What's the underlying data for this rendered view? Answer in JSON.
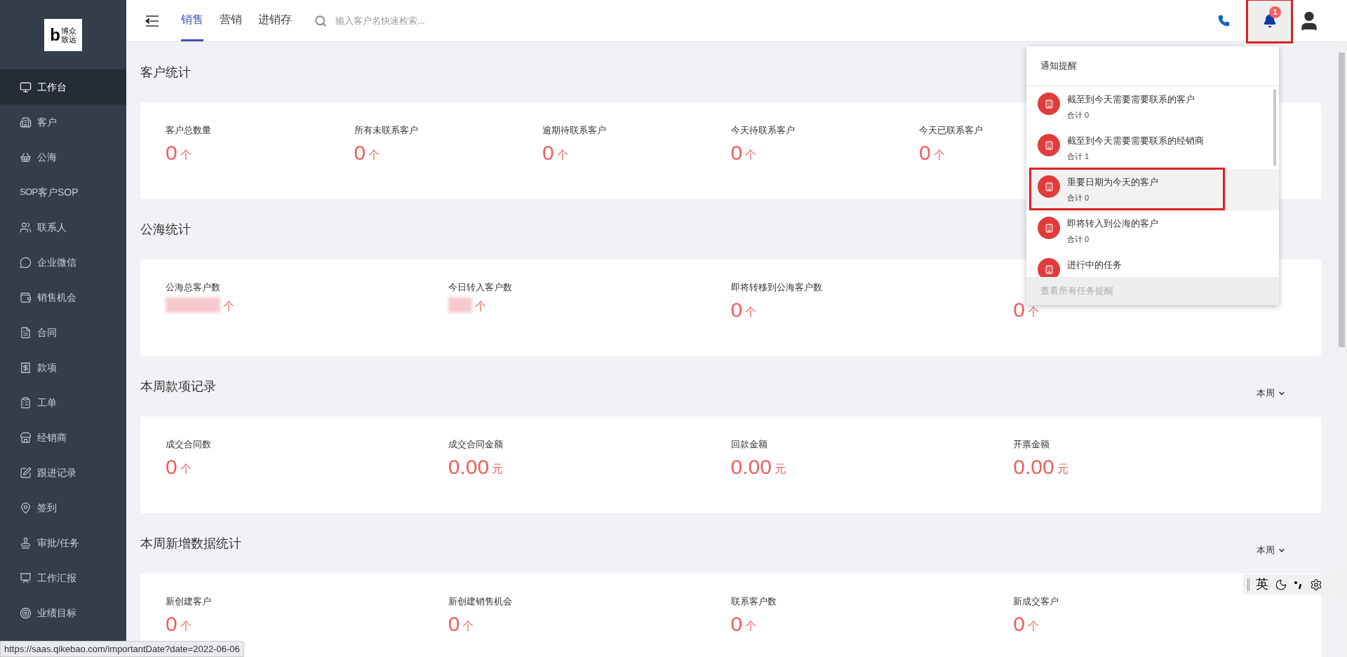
{
  "logo": {
    "mark": "b",
    "lines": [
      "博众",
      "致远"
    ]
  },
  "sidebar": {
    "items": [
      {
        "label": "工作台",
        "selected": true
      },
      {
        "label": "客户",
        "selected": false
      },
      {
        "label": "公海",
        "selected": false
      },
      {
        "label": "客户SOP",
        "selected": false,
        "icon_text": "SOP"
      },
      {
        "label": "联系人",
        "selected": false
      },
      {
        "label": "企业微信",
        "selected": false
      },
      {
        "label": "销售机会",
        "selected": false
      },
      {
        "label": "合同",
        "selected": false
      },
      {
        "label": "款项",
        "selected": false
      },
      {
        "label": "工单",
        "selected": false
      },
      {
        "label": "经销商",
        "selected": false
      },
      {
        "label": "跟进记录",
        "selected": false
      },
      {
        "label": "签到",
        "selected": false
      },
      {
        "label": "审批/任务",
        "selected": false
      },
      {
        "label": "工作汇报",
        "selected": false
      },
      {
        "label": "业绩目标",
        "selected": false
      }
    ]
  },
  "tabs": [
    {
      "label": "销售",
      "selected": true
    },
    {
      "label": "营销",
      "selected": false
    },
    {
      "label": "进销存",
      "selected": false
    }
  ],
  "search": {
    "placeholder": "输入客户名快速检索..."
  },
  "notifications": {
    "badge": "1",
    "highlighted": true,
    "title": "通知提醒",
    "footer": "查看所有任务提醒",
    "items": [
      {
        "title": "截至到今天需要需要联系的客户",
        "count": "合计 0",
        "highlighted": false
      },
      {
        "title": "截至到今天需要需要联系的经销商",
        "count": "合计 1",
        "highlighted": false
      },
      {
        "title": "重要日期为今天的客户",
        "count": "合计 0",
        "highlighted": true
      },
      {
        "title": "即将转入到公海的客户",
        "count": "合计 0",
        "highlighted": false
      },
      {
        "title": "进行中的任务",
        "highlighted": false
      }
    ]
  },
  "sections": [
    {
      "title": "客户统计",
      "items": [
        {
          "label": "客户总数量",
          "value": "0",
          "unit": "个",
          "kind": "number"
        },
        {
          "label": "所有未联系客户",
          "value": "0",
          "unit": "个",
          "kind": "number"
        },
        {
          "label": "逾期待联系客户",
          "value": "0",
          "unit": "个",
          "kind": "number"
        },
        {
          "label": "今天待联系客户",
          "value": "0",
          "unit": "个",
          "kind": "number"
        },
        {
          "label": "今天已联系客户",
          "value": "0",
          "unit": "个",
          "kind": "number"
        }
      ]
    },
    {
      "title": "公海统计",
      "items": [
        {
          "label": "公海总客户数",
          "unit": "个",
          "kind": "blurred"
        },
        {
          "label": "今日转入客户数",
          "unit": "个",
          "kind": "blurred"
        },
        {
          "label": "即将转移到公海客户数",
          "value": "0",
          "unit": "个",
          "kind": "number"
        },
        {
          "value": "0",
          "unit": "个",
          "kind": "number"
        }
      ]
    },
    {
      "title": "本周款项记录",
      "period": "本周",
      "items": [
        {
          "label": "成交合同数",
          "value": "0",
          "unit": "个",
          "kind": "number"
        },
        {
          "label": "成交合同金额",
          "value": "0.00",
          "unit": "元",
          "kind": "number"
        },
        {
          "label": "回款金额",
          "value": "0.00",
          "unit": "元",
          "kind": "number"
        },
        {
          "label": "开票金额",
          "value": "0.00",
          "unit": "元",
          "kind": "number"
        }
      ]
    },
    {
      "title": "本周新增数据统计",
      "period": "本周",
      "items": [
        {
          "label": "新创建客户",
          "value": "0",
          "unit": "个",
          "kind": "number"
        },
        {
          "label": "新创建销售机会",
          "value": "0",
          "unit": "个",
          "kind": "number"
        },
        {
          "label": "联系客户数",
          "value": "0",
          "unit": "个",
          "kind": "number"
        },
        {
          "label": "新成交客户",
          "value": "0",
          "unit": "个",
          "kind": "number"
        }
      ]
    }
  ],
  "ime": {
    "mode": "英"
  },
  "status_url": "https://saas.qikebao.com/importantDate?date=2022-06-06"
}
